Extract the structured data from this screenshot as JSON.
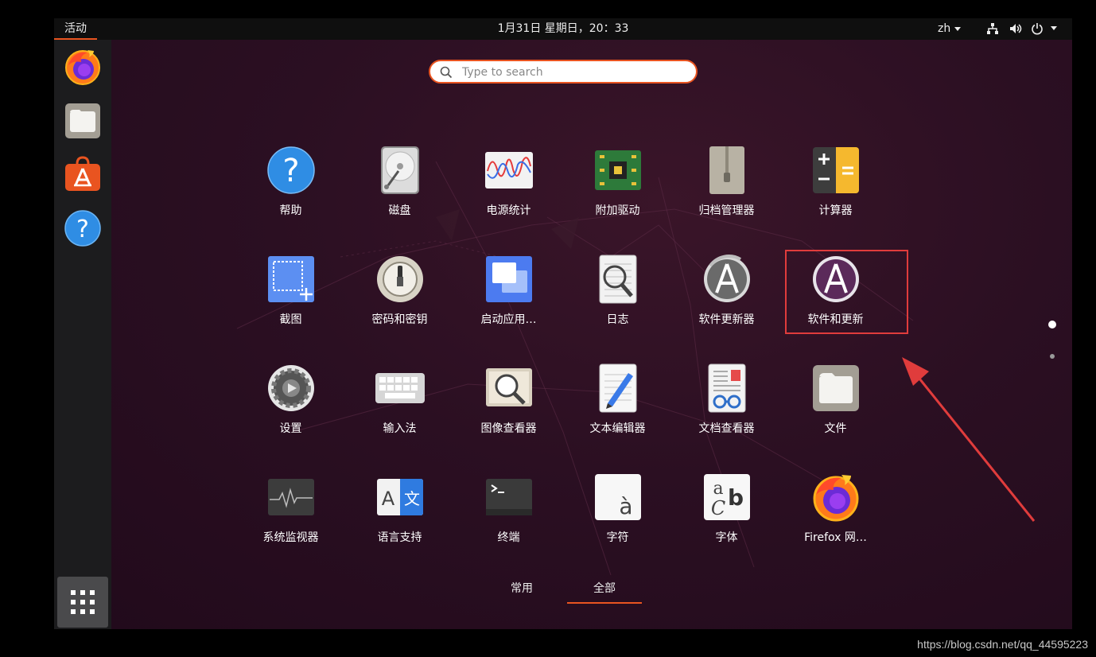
{
  "topbar": {
    "activities": "活动",
    "clock": "1月31日 星期日，20：33",
    "lang": "zh"
  },
  "search": {
    "placeholder": "Type to search"
  },
  "dock": {
    "items": [
      "firefox-icon",
      "files-icon",
      "software-icon",
      "help-icon"
    ],
    "show_apps": "show-apps-icon"
  },
  "apps": [
    {
      "label": "帮助",
      "icon": "help-icon"
    },
    {
      "label": "磁盘",
      "icon": "disks-icon"
    },
    {
      "label": "电源统计",
      "icon": "power-statistics-icon"
    },
    {
      "label": "附加驱动",
      "icon": "additional-drivers-icon"
    },
    {
      "label": "归档管理器",
      "icon": "archive-manager-icon"
    },
    {
      "label": "计算器",
      "icon": "calculator-icon"
    },
    {
      "label": "截图",
      "icon": "screenshot-icon"
    },
    {
      "label": "密码和密钥",
      "icon": "passwords-keys-icon"
    },
    {
      "label": "启动应用…",
      "icon": "startup-apps-icon"
    },
    {
      "label": "日志",
      "icon": "logs-icon"
    },
    {
      "label": "软件更新器",
      "icon": "software-updater-icon"
    },
    {
      "label": "软件和更新",
      "icon": "software-updates-icon"
    },
    {
      "label": "设置",
      "icon": "settings-icon"
    },
    {
      "label": "输入法",
      "icon": "input-method-icon"
    },
    {
      "label": "图像查看器",
      "icon": "image-viewer-icon"
    },
    {
      "label": "文本编辑器",
      "icon": "text-editor-icon"
    },
    {
      "label": "文档查看器",
      "icon": "document-viewer-icon"
    },
    {
      "label": "文件",
      "icon": "files-icon"
    },
    {
      "label": "系统监视器",
      "icon": "system-monitor-icon"
    },
    {
      "label": "语言支持",
      "icon": "language-support-icon"
    },
    {
      "label": "终端",
      "icon": "terminal-icon"
    },
    {
      "label": "字符",
      "icon": "characters-icon"
    },
    {
      "label": "字体",
      "icon": "fonts-icon"
    },
    {
      "label": "Firefox 网…",
      "icon": "firefox-icon"
    }
  ],
  "tabs": {
    "frequent": "常用",
    "all": "全部"
  },
  "colors": {
    "accent": "#e95420",
    "highlight": "#e03c3c"
  },
  "watermark": "https://blog.csdn.net/qq_44595223"
}
